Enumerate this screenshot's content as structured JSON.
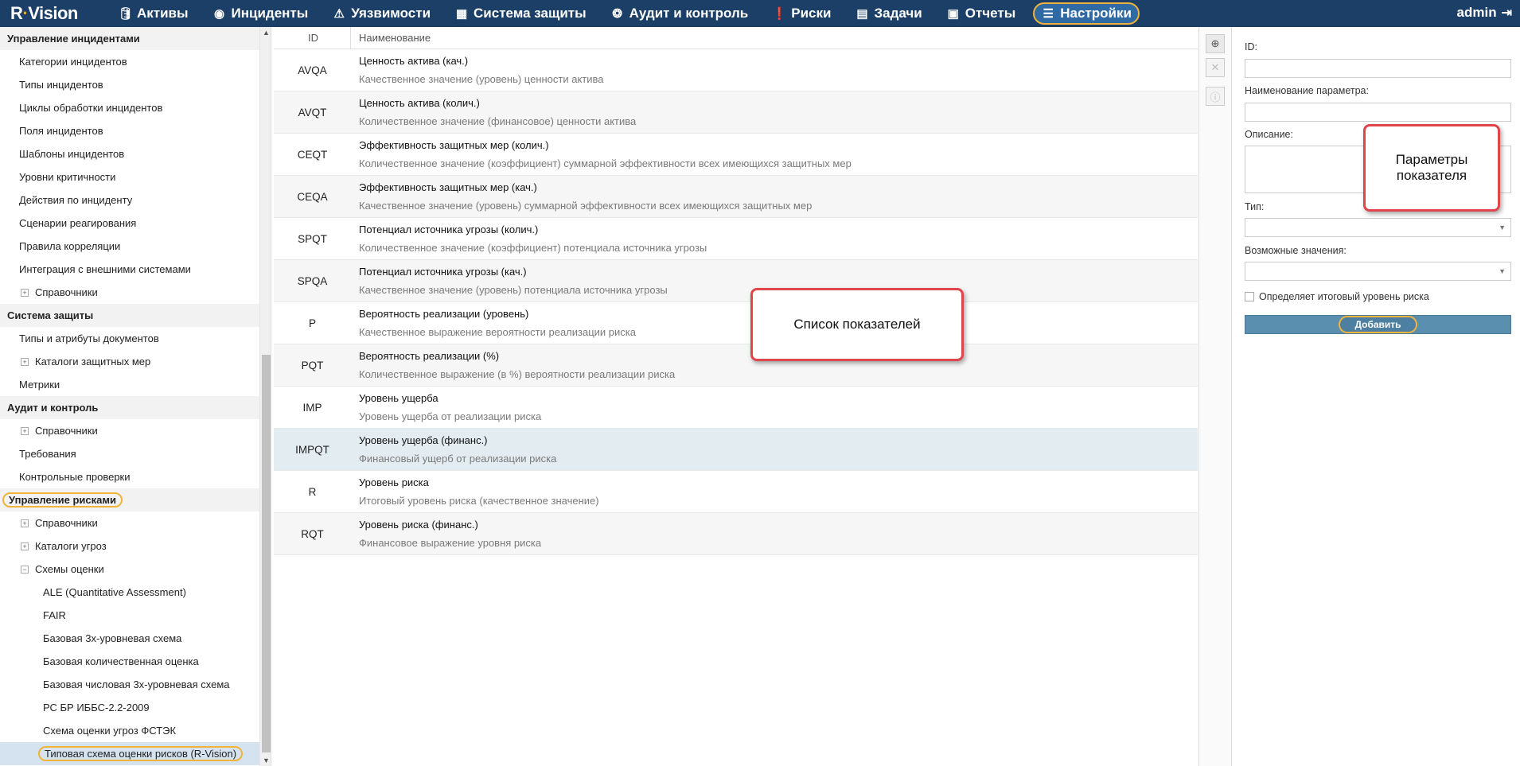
{
  "app": {
    "logo_prefix": "R",
    "logo_dot": "·",
    "logo_suffix": "Vision"
  },
  "nav": [
    {
      "icon": "database-icon",
      "glyph": "🛢",
      "label": "Активы"
    },
    {
      "icon": "target-icon",
      "glyph": "◉",
      "label": "Инциденты"
    },
    {
      "icon": "warning-icon",
      "glyph": "⚠",
      "label": "Уязвимости"
    },
    {
      "icon": "shield-grid-icon",
      "glyph": "▦",
      "label": "Система защиты"
    },
    {
      "icon": "cycle-icon",
      "glyph": "❂",
      "label": "Аудит и контроль"
    },
    {
      "icon": "exclamation-icon",
      "glyph": "❗",
      "label": "Риски"
    },
    {
      "icon": "tasks-icon",
      "glyph": "▤",
      "label": "Задачи"
    },
    {
      "icon": "report-icon",
      "glyph": "▣",
      "label": "Отчеты"
    },
    {
      "icon": "menu-icon",
      "glyph": "☰",
      "label": "Настройки"
    }
  ],
  "user": {
    "name": "admin",
    "logout_glyph": "⇥"
  },
  "sidebar": {
    "items": [
      {
        "type": "header",
        "label": "Управление инцидентами"
      },
      {
        "type": "item",
        "label": "Категории инцидентов"
      },
      {
        "type": "item",
        "label": "Типы инцидентов"
      },
      {
        "type": "item",
        "label": "Циклы обработки инцидентов"
      },
      {
        "type": "item",
        "label": "Поля инцидентов"
      },
      {
        "type": "item",
        "label": "Шаблоны инцидентов"
      },
      {
        "type": "item",
        "label": "Уровни критичности"
      },
      {
        "type": "item",
        "label": "Действия по инциденту"
      },
      {
        "type": "item",
        "label": "Сценарии реагирования"
      },
      {
        "type": "item",
        "label": "Правила корреляции"
      },
      {
        "type": "item",
        "label": "Интеграция с внешними системами"
      },
      {
        "type": "folder",
        "label": "Справочники",
        "state": "collapsed"
      },
      {
        "type": "header",
        "label": "Система защиты"
      },
      {
        "type": "item",
        "label": "Типы и атрибуты документов"
      },
      {
        "type": "folder",
        "label": "Каталоги защитных мер",
        "state": "collapsed"
      },
      {
        "type": "item",
        "label": "Метрики"
      },
      {
        "type": "header",
        "label": "Аудит и контроль"
      },
      {
        "type": "folder",
        "label": "Справочники",
        "state": "collapsed"
      },
      {
        "type": "item",
        "label": "Требования"
      },
      {
        "type": "item",
        "label": "Контрольные проверки"
      },
      {
        "type": "header",
        "label": "Управление рисками",
        "highlight": true
      },
      {
        "type": "folder",
        "label": "Справочники",
        "state": "collapsed"
      },
      {
        "type": "folder",
        "label": "Каталоги угроз",
        "state": "collapsed"
      },
      {
        "type": "folder",
        "label": "Схемы оценки",
        "state": "expanded"
      },
      {
        "type": "sub",
        "label": "ALE (Quantitative Assessment)"
      },
      {
        "type": "sub",
        "label": "FAIR"
      },
      {
        "type": "sub",
        "label": "Базовая 3х-уровневая схема"
      },
      {
        "type": "sub",
        "label": "Базовая количественная оценка"
      },
      {
        "type": "sub",
        "label": "Базовая числовая 3х-уровневая схема"
      },
      {
        "type": "sub",
        "label": "РС БР ИББС-2.2-2009"
      },
      {
        "type": "sub",
        "label": "Схема оценки угроз ФСТЭК"
      },
      {
        "type": "sub",
        "label": "Типовая схема оценки рисков (R-Vision)",
        "selected": true,
        "highlight": true
      }
    ]
  },
  "table": {
    "col_id": "ID",
    "col_name": "Наименование",
    "rows": [
      {
        "id": "AVQA",
        "name": "Ценность актива (кач.)",
        "desc": "Качественное значение (уровень) ценности актива"
      },
      {
        "id": "AVQT",
        "name": "Ценность актива (колич.)",
        "desc": "Количественное значение (финансовое) ценности актива"
      },
      {
        "id": "CEQT",
        "name": "Эффективность защитных мер (колич.)",
        "desc": "Количественное значение (коэффициент) суммарной эффективности всех имеющихся защитных мер"
      },
      {
        "id": "CEQA",
        "name": "Эффективность защитных мер (кач.)",
        "desc": "Качественное значение (уровень) суммарной эффективности всех имеющихся защитных мер"
      },
      {
        "id": "SPQT",
        "name": "Потенциал источника угрозы (колич.)",
        "desc": "Количественное значение (коэффициент) потенциала источника угрозы"
      },
      {
        "id": "SPQA",
        "name": "Потенциал источника угрозы (кач.)",
        "desc": "Качественное значение (уровень) потенциала источника угрозы"
      },
      {
        "id": "P",
        "name": "Вероятность реализации (уровень)",
        "desc": "Качественное выражение вероятности реализации риска"
      },
      {
        "id": "PQT",
        "name": "Вероятность реализации (%)",
        "desc": "Количественное выражение (в %) вероятности реализации риска"
      },
      {
        "id": "IMP",
        "name": "Уровень ущерба",
        "desc": "Уровень ущерба от реализации риска"
      },
      {
        "id": "IMPQT",
        "name": "Уровень ущерба (финанс.)",
        "desc": "Финансовый ущерб от реализации риска",
        "selected": true
      },
      {
        "id": "R",
        "name": "Уровень риска",
        "desc": "Итоговый уровень риска (качественное значение)"
      },
      {
        "id": "RQT",
        "name": "Уровень риска (финанс.)",
        "desc": "Финансовое выражение уровня риска"
      }
    ]
  },
  "tools": {
    "add_glyph": "⊕",
    "delete_glyph": "✕",
    "info_glyph": "ⓘ"
  },
  "form": {
    "id_label": "ID:",
    "name_label": "Наименование параметра:",
    "desc_label": "Описание:",
    "type_label": "Тип:",
    "values_label": "Возможные значения:",
    "final_label": "Определяет итоговый уровень риска",
    "add_label": "Добавить"
  },
  "callouts": {
    "list": "Список показателей",
    "params": "Параметры показателя"
  },
  "colors": {
    "topbar": "#1b3f66",
    "highlight": "#f1b33a",
    "callout_border": "#e0454b",
    "button": "#5b8fb0"
  }
}
